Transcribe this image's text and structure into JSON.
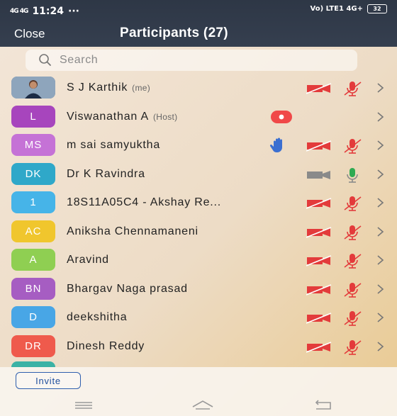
{
  "status_bar": {
    "signal_left": "4G 4G",
    "time": "11:24",
    "dots": "···",
    "right_text": "Vo) LTE1 4G+",
    "battery": "32"
  },
  "header": {
    "close_label": "Close",
    "title": "Participants (27)"
  },
  "search": {
    "placeholder": "Search"
  },
  "participants": [
    {
      "initials": "",
      "avatar_color": "#6b87a3",
      "name": "S J Karthik",
      "tag": "(me)",
      "camera": "off",
      "mic": "muted",
      "photo": true
    },
    {
      "initials": "L",
      "avatar_color": "#a745bd",
      "name": "Viswanathan A",
      "tag": "(Host)",
      "camera": "none",
      "mic": "none",
      "recording": true
    },
    {
      "initials": "MS",
      "avatar_color": "#c572d6",
      "name": "m sai samyuktha",
      "tag": "",
      "camera": "off",
      "mic": "muted",
      "hand": true
    },
    {
      "initials": "DK",
      "avatar_color": "#2fa8c9",
      "name": "Dr K Ravindra",
      "tag": "",
      "camera": "on",
      "mic": "on"
    },
    {
      "initials": "1",
      "avatar_color": "#46b4e8",
      "name": "18S11A05C4  -  Akshay Re...",
      "tag": "",
      "camera": "off",
      "mic": "muted"
    },
    {
      "initials": "AC",
      "avatar_color": "#f0c62d",
      "name": "Aniksha Chennamaneni",
      "tag": "",
      "camera": "off",
      "mic": "muted"
    },
    {
      "initials": "A",
      "avatar_color": "#8fcf52",
      "name": "Aravind",
      "tag": "",
      "camera": "off",
      "mic": "muted"
    },
    {
      "initials": "BN",
      "avatar_color": "#a65dc2",
      "name": "Bhargav Naga prasad",
      "tag": "",
      "camera": "off",
      "mic": "muted"
    },
    {
      "initials": "D",
      "avatar_color": "#48a6e6",
      "name": "deekshitha",
      "tag": "",
      "camera": "off",
      "mic": "muted"
    },
    {
      "initials": "DR",
      "avatar_color": "#ef5a4c",
      "name": "Dinesh Reddy",
      "tag": "",
      "camera": "off",
      "mic": "muted"
    }
  ],
  "footer": {
    "invite_label": "Invite"
  },
  "colors": {
    "header_bg": "#323c4b",
    "muted_red": "#e33b3b",
    "link_blue": "#1f4f9e"
  }
}
